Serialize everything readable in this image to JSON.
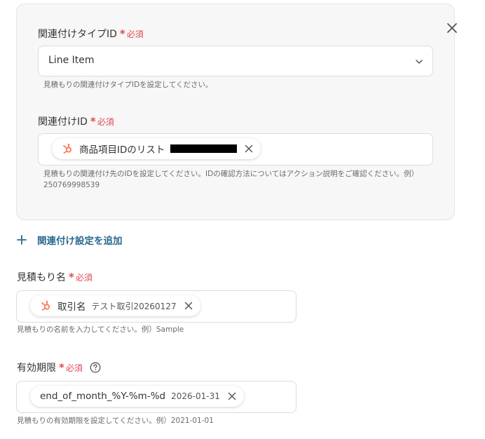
{
  "required_label": "必須",
  "card": {
    "type_field": {
      "label": "関連付けタイプID",
      "value": "Line Item",
      "help": "見積もりの関連付けタイプIDを設定してください。"
    },
    "id_field": {
      "label": "関連付けID",
      "chip_name": "商品項目IDのリスト",
      "help_line1": "見積もりの関連付け先のIDを設定してください。IDの確認方法についてはアクション説明をご確認ください。例）",
      "help_line2": "250769998539"
    }
  },
  "add_association": "関連付け設定を追加",
  "quote_name": {
    "label": "見積もり名",
    "chip_name": "取引名",
    "chip_value": "テスト取引20260127",
    "help": "見積もりの名前を入力してください。例）Sample"
  },
  "expiry": {
    "label": "有効期限",
    "chip_name": "end_of_month_%Y-%m-%d",
    "chip_value": "2026-01-31",
    "help": "見積もりの有効期限を設定してください。例）2021-01-01"
  },
  "colors": {
    "required": "#e0484e",
    "accent": "#2b6a8f",
    "hubspot": "#ff7a59"
  },
  "icons": [
    "close-icon",
    "chevron-down-icon",
    "hubspot-icon",
    "remove-icon",
    "plus-icon",
    "help-icon"
  ]
}
